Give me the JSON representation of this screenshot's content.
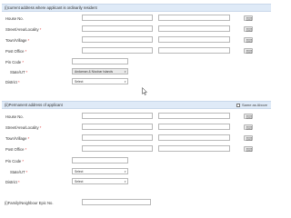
{
  "current": {
    "title": "(i)current address where applicant is ordinarily resident",
    "house_label": "House No.",
    "street_label": "Street/Area/Locality",
    "town_label": "Town/Village",
    "post_label": "Post Office",
    "pin_label": "Pin Code",
    "state_label": "State/UT",
    "state_value": "Andaman & Nicobar Islands",
    "district_label": "District",
    "district_value": "Select"
  },
  "permanent": {
    "title": "(ii)Permanent address of applicant",
    "same_label": "Same as Above",
    "house_label": "House No.",
    "street_label": "Street/Area/Locality",
    "town_label": "Town/Village",
    "post_label": "Post Office",
    "pin_label": "Pin Code",
    "state_label": "State/UT",
    "state_value": "Select",
    "district_label": "District",
    "district_value": "Select"
  },
  "family": {
    "label": "(i)Family/Neighbour Epic No."
  },
  "required_mark": "*",
  "icons": {
    "keyboard": "keyboard-icon",
    "dropdown": "chevron-down-icon",
    "cursor": "mouse-pointer-icon"
  },
  "colors": {
    "section_band": "#dfeaf7",
    "required": "#e23a3a"
  }
}
